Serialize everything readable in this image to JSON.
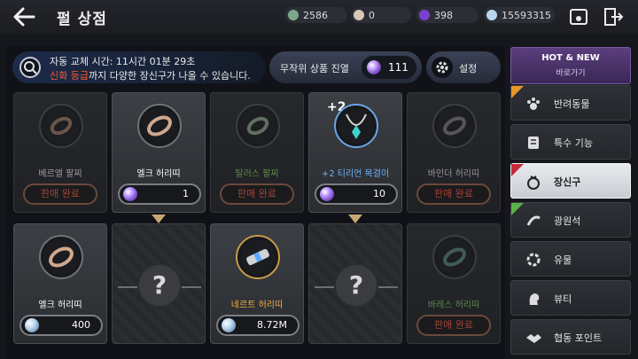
{
  "header": {
    "title": "펄 상점",
    "currencies": [
      {
        "value": "2586",
        "color": "#7ba88a"
      },
      {
        "value": "0",
        "color": "#d9c6b4"
      },
      {
        "value": "398",
        "color": "#7a3fd1"
      },
      {
        "value": "15593315",
        "color": "#b9d6ef"
      }
    ]
  },
  "info": {
    "line1": "자동 교체 시간: 11시간 01분 29초",
    "line2_highlight": "신화 등급",
    "line2_rest": "까지 다양한 장신구가 나올 수 있습니다."
  },
  "random": {
    "label": "무작위 상품 진열",
    "count": "111"
  },
  "settings": {
    "label": "설정"
  },
  "cards": [
    {
      "name": "베르엘 팔찌",
      "name_color": "#9a9a9a",
      "state": "sold",
      "sold_label": "판매 완료"
    },
    {
      "name": "엘크 허리띠",
      "name_color": "#ffffff",
      "state": "price",
      "price": "1",
      "currency_icon": "purple-gem-icon"
    },
    {
      "name": "탈러스 팔찌",
      "name_color": "#5f8a4c",
      "state": "sold",
      "sold_label": "판매 완료"
    },
    {
      "name": "+2 티리언 목걸이",
      "name_color": "#6fb3ff",
      "state": "price",
      "price": "10",
      "currency_icon": "purple-gem-icon",
      "enhance": "+2"
    },
    {
      "name": "바인더 허리띠",
      "name_color": "#9a9a9a",
      "state": "sold",
      "sold_label": "판매 완료"
    },
    {
      "name": "엘크 허리띠",
      "name_color": "#ffffff",
      "state": "price",
      "price": "400",
      "currency_icon": "silver-coin-icon"
    },
    {
      "name": "",
      "state": "mystery",
      "symbol": "?"
    },
    {
      "name": "네르트 허리띠",
      "name_color": "#f0b040",
      "state": "price",
      "price": "8.72M",
      "currency_icon": "silver-coin-icon"
    },
    {
      "name": "",
      "state": "mystery",
      "symbol": "?"
    },
    {
      "name": "바레스 허리띠",
      "name_color": "#5f8a4c",
      "state": "sold",
      "sold_label": "판매 완료"
    }
  ],
  "sidebar": {
    "hot_title": "HOT & NEW",
    "hot_sub": "바로가기",
    "items": [
      {
        "label": "반려동물",
        "icon": "paw-icon",
        "tag": "#e8962a"
      },
      {
        "label": "특수 기능",
        "icon": "scroll-icon"
      },
      {
        "label": "장신구",
        "icon": "ring-icon",
        "tag": "#c8283c",
        "active": true
      },
      {
        "label": "광원석",
        "icon": "crystal-icon",
        "tag": "#5ab34a"
      },
      {
        "label": "유물",
        "icon": "relic-icon"
      },
      {
        "label": "뷰티",
        "icon": "face-icon"
      },
      {
        "label": "협동 포인트",
        "icon": "handshake-icon"
      }
    ]
  }
}
